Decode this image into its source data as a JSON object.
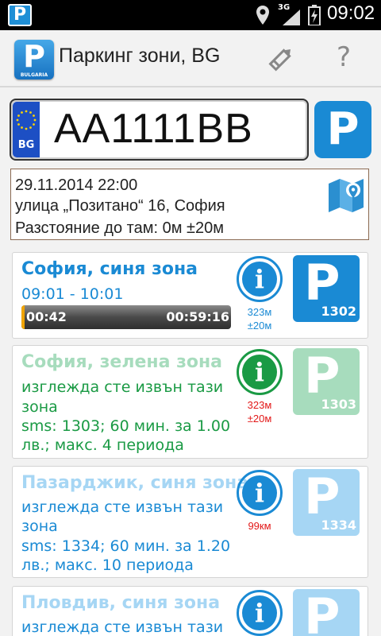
{
  "statusbar": {
    "app_icon": "P",
    "network": "3G",
    "time": "09:02"
  },
  "actionbar": {
    "logo": "P",
    "logo_sub": "BULGARIA",
    "title": "Паркинг зони, BG",
    "edit_icon": "pencil-icon",
    "help_icon": "?"
  },
  "plate": {
    "country": "BG",
    "number": "AA1111BB"
  },
  "park_button": "P",
  "location": {
    "datetime": "29.11.2014 22:00",
    "address": "улица „Позитано“ 16, София",
    "distance": "Разстояние до там: 0м ±20м"
  },
  "colors": {
    "blue": "#1a8ad4",
    "green": "#1a9a44",
    "green_light": "#a7dcbd",
    "blue_light": "#a6d6f4",
    "red": "#e21818"
  },
  "zones": [
    {
      "title": "София, синя зона",
      "period": "09:01 - 10:01",
      "elapsed": "00:42",
      "remaining": "00:59:16",
      "progress": 0.012,
      "dist1": "323м",
      "dist2": "±20м",
      "number": "1302"
    },
    {
      "title": "София, зелена зона",
      "line1": "изглежда сте извън тази",
      "line2": "зона",
      "line3": "sms: 1303; 60 мин. за 1.00",
      "line4": "лв.; макс. 4 периода",
      "dist1": "323м",
      "dist2": "±20м",
      "number": "1303"
    },
    {
      "title": "Пазарджик, синя зона",
      "line1": "изглежда сте извън тази",
      "line2": "зона",
      "line3": "sms: 1334; 60 мин. за 1.20",
      "line4": "лв.; макс. 10 периода",
      "dist1": "99км",
      "number": "1334"
    },
    {
      "title": "Пловдив, синя зона",
      "line1": "изглежда сте извън тази"
    }
  ]
}
